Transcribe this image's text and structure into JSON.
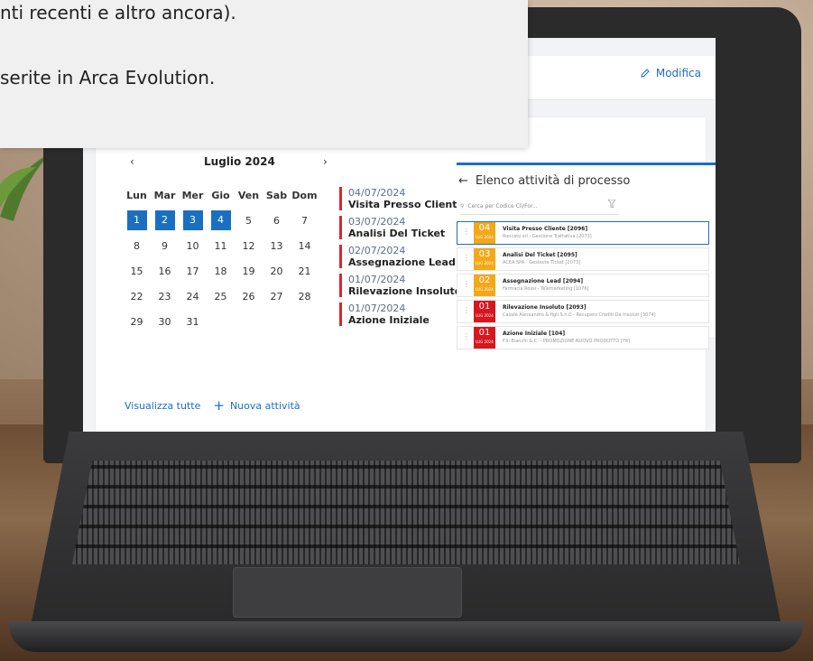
{
  "caption": {
    "line1": "nti recenti e altro ancora).",
    "line2": "serite in Arca Evolution."
  },
  "app": {
    "edit_label": "Modifica",
    "calendar": {
      "month": "Luglio 2024",
      "weekdays": [
        "Lun",
        "Mar",
        "Mer",
        "Gio",
        "Ven",
        "Sab",
        "Dom"
      ],
      "weeks": [
        [
          "1",
          "2",
          "3",
          "4",
          "5",
          "6",
          "7"
        ],
        [
          "8",
          "9",
          "10",
          "11",
          "12",
          "13",
          "14"
        ],
        [
          "15",
          "16",
          "17",
          "18",
          "19",
          "20",
          "21"
        ],
        [
          "22",
          "23",
          "24",
          "25",
          "26",
          "27",
          "28"
        ],
        [
          "29",
          "30",
          "31",
          "",
          "",
          "",
          ""
        ]
      ],
      "selected_days": [
        "1",
        "2",
        "3",
        "4"
      ]
    },
    "events": [
      {
        "date": "04/07/2024",
        "title": "Visita Presso Cliente"
      },
      {
        "date": "03/07/2024",
        "title": "Analisi Del Ticket"
      },
      {
        "date": "02/07/2024",
        "title": "Assegnazione Lead"
      },
      {
        "date": "01/07/2024",
        "title": "Rilevazione Insoluto"
      },
      {
        "date": "01/07/2024",
        "title": "Azione Iniziale"
      }
    ],
    "footer": {
      "view_all": "Visualizza tutte",
      "new_activity": "Nuova attività"
    },
    "panel": {
      "title": "Elenco attività di processo",
      "search_placeholder": "Cerca per Codice Cli/For...",
      "items": [
        {
          "day": "04",
          "month": "LUG 2024",
          "title": "Visita Presso Cliente [2096]",
          "sub": "Roncato srl - Gestione Trattativa [2073]",
          "color": "#f3a818"
        },
        {
          "day": "03",
          "month": "LUG 2024",
          "title": "Analisi Del Ticket [2095]",
          "sub": "ACEA SPA - Gestione Ticket [2073]",
          "color": "#f3a818"
        },
        {
          "day": "02",
          "month": "LUG 2024",
          "title": "Assegnazione Lead [2094]",
          "sub": "Farmacia Rossi - Telemarketing [1076]",
          "color": "#f3a818"
        },
        {
          "day": "01",
          "month": "LUG 2024",
          "title": "Rilevazione Insoluto [2093]",
          "sub": "Casale Alessandro & figli S.n.C - Recupero Crediti Da Insoluti [3074]",
          "color": "#d8161f"
        },
        {
          "day": "01",
          "month": "LUG 2024",
          "title": "Azione Iniziale [104]",
          "sub": "F.lli Bianchi & C. - PROMOZIONE NUOVO PRODOTTO [78]",
          "color": "#d8161f"
        }
      ]
    }
  }
}
